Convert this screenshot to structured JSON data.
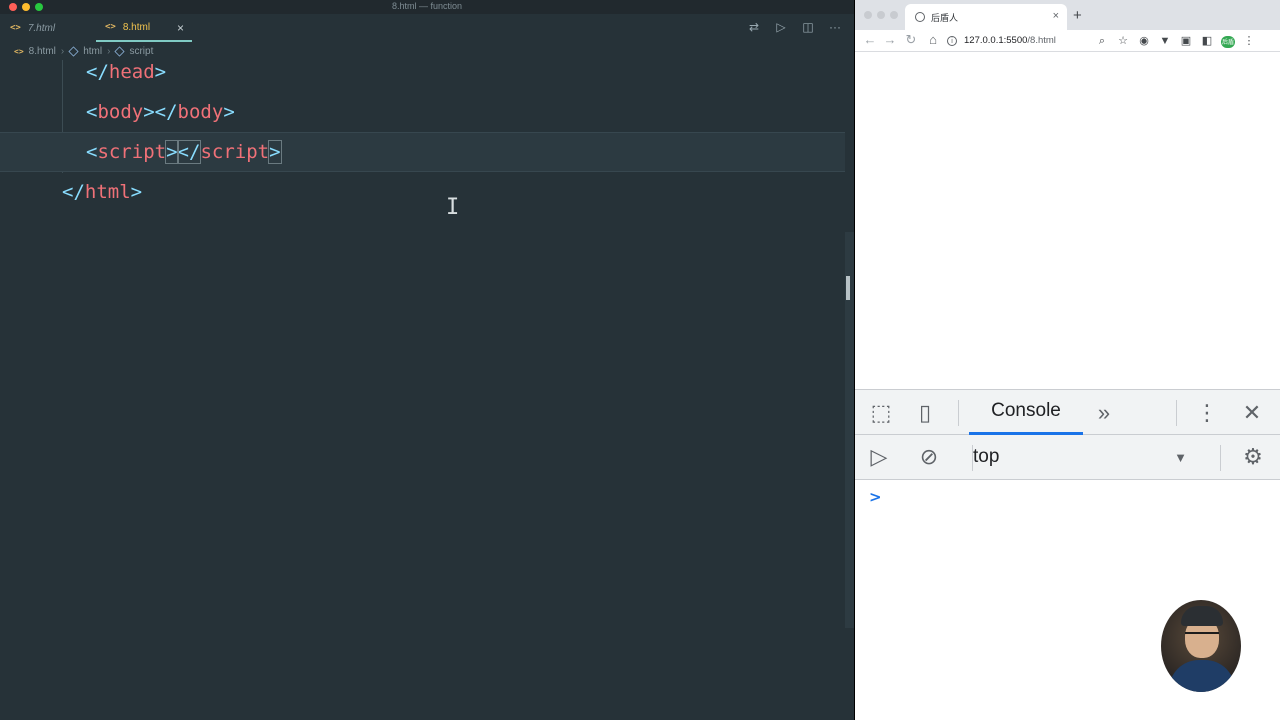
{
  "editor": {
    "window_title": "8.html — function",
    "tabs": [
      {
        "label": "7.html",
        "active": false
      },
      {
        "label": "8.html",
        "active": true
      }
    ],
    "tab_icon_glyph": "<>",
    "close_glyph": "×",
    "actions": {
      "split_compare_glyph": "⇄",
      "run_glyph": "▷",
      "split_glyph": "◫",
      "more_glyph": "···"
    },
    "breadcrumb": {
      "file": "8.html",
      "element_1": "html",
      "element_2": "script"
    },
    "code_lines": [
      {
        "open": "</",
        "tag": "head",
        "close": ">"
      },
      {
        "p1": "<",
        "t1": "body",
        "p2": "></",
        "t2": "body",
        "p3": ">"
      },
      {
        "p1": "<",
        "t1": "script",
        "p2": ">",
        "p3": "</",
        "t2": "script",
        "p4": ">"
      },
      {
        "open": "</",
        "tag": "html",
        "close": ">"
      }
    ],
    "cursor_glyph": "I"
  },
  "browser": {
    "tab_title": "后盾人",
    "tab_close": "×",
    "new_tab": "+",
    "nav": {
      "back": "←",
      "forward": "→",
      "reload": "↻",
      "home": "⌂"
    },
    "url": {
      "host": "127.0.0.1",
      "port": ":5500",
      "path": "/8.html"
    },
    "info_glyph": "i",
    "toolbar_icons": {
      "zoom": "⌕",
      "star": "☆",
      "ext1": "◉",
      "ext2": "▼",
      "ext3": "▣",
      "ext4": "◧",
      "avatar": "后盾",
      "menu": "⋮"
    }
  },
  "devtools": {
    "inspect_glyph": "⬚",
    "device_glyph": "▯",
    "console_tab": "Console",
    "more_tabs_glyph": "»",
    "kebab_glyph": "⋮",
    "close_glyph": "✕",
    "sidebar_glyph": "▷",
    "clear_glyph": "⊘",
    "context": "top",
    "caret": "▼",
    "gear_glyph": "⚙",
    "prompt": ">"
  },
  "colors": {
    "editor_bg": "#263238",
    "tag": "#f07178",
    "punctuation": "#89ddff",
    "active_tab_text": "#f0c34e",
    "devtools_accent": "#1a73e8"
  }
}
